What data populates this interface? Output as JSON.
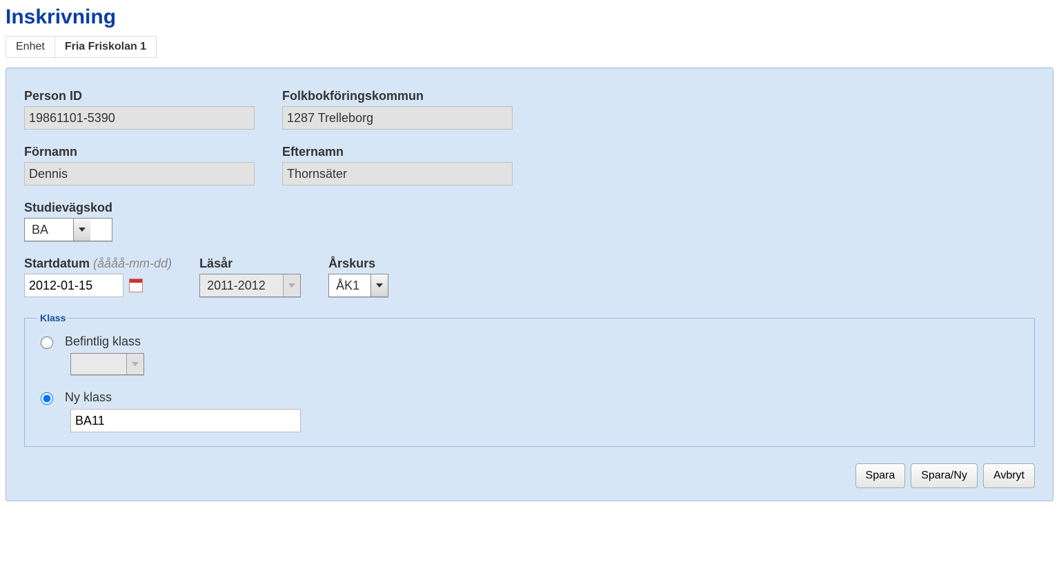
{
  "page": {
    "title": "Inskrivning"
  },
  "breadcrumb": {
    "label": "Enhet",
    "value": "Fria Friskolan 1"
  },
  "fields": {
    "person_id": {
      "label": "Person ID",
      "value": "19861101-5390"
    },
    "kommun": {
      "label": "Folkbokföringskommun",
      "value": "1287 Trelleborg"
    },
    "fornamn": {
      "label": "Förnamn",
      "value": "Dennis"
    },
    "efternamn": {
      "label": "Efternamn",
      "value": "Thornsäter"
    },
    "studievagskod": {
      "label": "Studievägskod",
      "value": "BA"
    },
    "startdatum": {
      "label": "Startdatum",
      "hint": "(åååå-mm-dd)",
      "value": "2012-01-15"
    },
    "lasar": {
      "label": "Läsår",
      "value": "2011-2012"
    },
    "arskurs": {
      "label": "Årskurs",
      "value": "ÅK1"
    }
  },
  "klass": {
    "legend": "Klass",
    "befintlig": {
      "label": "Befintlig klass",
      "value": ""
    },
    "ny": {
      "label": "Ny klass",
      "value": "BA11"
    }
  },
  "buttons": {
    "spara": "Spara",
    "spara_ny": "Spara/Ny",
    "avbryt": "Avbryt"
  }
}
